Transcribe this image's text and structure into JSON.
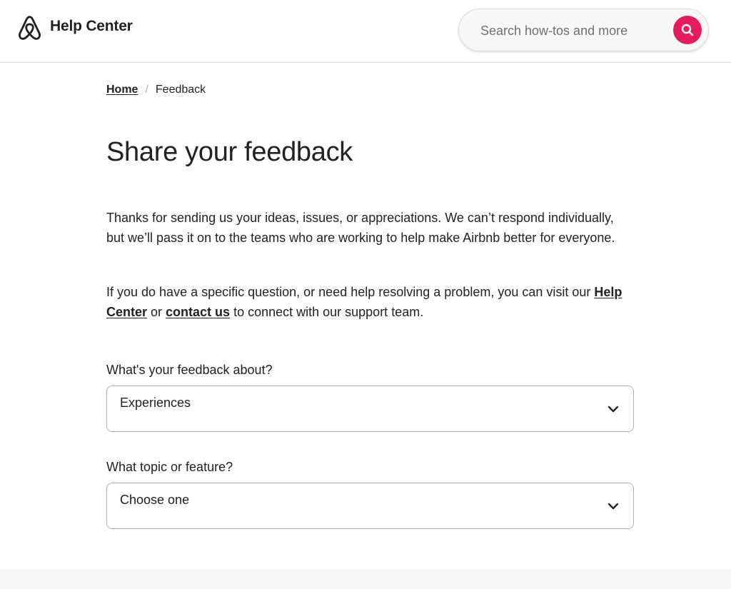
{
  "header": {
    "brand_title": "Help Center",
    "brand_color": "#222222",
    "search": {
      "placeholder": "Search how-tos and more",
      "button_color": "#e31c5f",
      "button_icon": "search-icon"
    },
    "logo_icon": "airbnb-logo-icon"
  },
  "breadcrumb": {
    "home_label": "Home",
    "separator": "/",
    "current_label": "Feedback"
  },
  "page": {
    "title": "Share your feedback",
    "intro": "Thanks for sending us your ideas, issues, or appreciations. We can’t respond individually, but we’ll pass it on to the teams who are working to help make Airbnb better for everyone.",
    "support_prefix": "If you do have a specific question, or need help resolving a problem, you can visit our ",
    "support_link_help": "Help Center",
    "support_or": " or ",
    "support_link_contact": "contact us",
    "support_suffix": " to connect with our support team."
  },
  "form": {
    "feedback_about": {
      "label": "What's your feedback about?",
      "selected": "Experiences"
    },
    "topic": {
      "label": "What topic or feature?",
      "selected": "Choose one"
    }
  }
}
